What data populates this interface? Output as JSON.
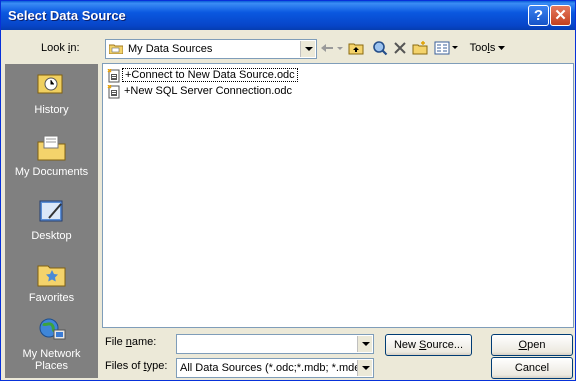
{
  "window": {
    "title": "Select Data Source"
  },
  "lookin": {
    "label_pre": "Look ",
    "label_u": "i",
    "label_post": "n:",
    "value": "My Data Sources"
  },
  "toolbar": {
    "tools_pre": "Too",
    "tools_u": "l",
    "tools_post": "s"
  },
  "places": [
    {
      "label": "History"
    },
    {
      "label": "My Documents"
    },
    {
      "label": "Desktop"
    },
    {
      "label": "Favorites"
    },
    {
      "label": "My Network\nPlaces"
    }
  ],
  "files": [
    {
      "name": "+Connect to New Data Source.odc"
    },
    {
      "name": "+New SQL Server Connection.odc"
    }
  ],
  "filename": {
    "label_pre": "File ",
    "label_u": "n",
    "label_post": "ame:",
    "value": ""
  },
  "filetype": {
    "label_pre": "Files of ",
    "label_u": "t",
    "label_post": "ype:",
    "value": "All Data Sources (*.odc;*.mdb; *.mde;"
  },
  "buttons": {
    "new_source_pre": "New ",
    "new_source_u": "S",
    "new_source_post": "ource...",
    "open_u": "O",
    "open_post": "pen",
    "cancel": "Cancel"
  },
  "colors": {
    "title_bar": "#0a58e0",
    "places_bar": "#808080",
    "dialog_bg": "#ece9d8"
  }
}
